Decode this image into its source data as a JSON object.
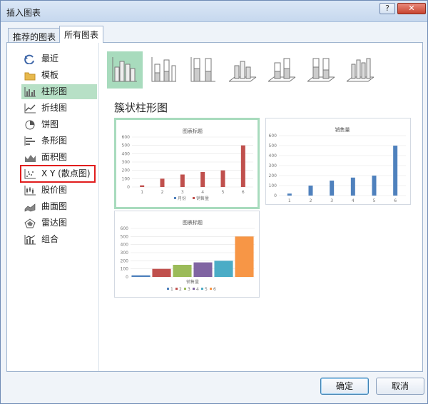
{
  "window": {
    "title": "插入图表",
    "help_glyph": "?",
    "close_glyph": "✕"
  },
  "tabs": [
    {
      "label": "推荐的图表"
    },
    {
      "label": "所有图表"
    }
  ],
  "sidebar": {
    "items": [
      {
        "label": "最近",
        "icon": "recent-icon"
      },
      {
        "label": "模板",
        "icon": "folder-icon"
      },
      {
        "label": "柱形图",
        "icon": "column-chart-icon"
      },
      {
        "label": "折线图",
        "icon": "line-chart-icon"
      },
      {
        "label": "饼图",
        "icon": "pie-chart-icon"
      },
      {
        "label": "条形图",
        "icon": "bar-chart-icon"
      },
      {
        "label": "面积图",
        "icon": "area-chart-icon"
      },
      {
        "label": "X Y (散点图)",
        "icon": "scatter-chart-icon"
      },
      {
        "label": "股价图",
        "icon": "stock-chart-icon"
      },
      {
        "label": "曲面图",
        "icon": "surface-chart-icon"
      },
      {
        "label": "雷达图",
        "icon": "radar-chart-icon"
      },
      {
        "label": "组合",
        "icon": "combo-chart-icon"
      }
    ],
    "selected_index": 2,
    "highlighted_index": 7
  },
  "subtype_heading": "簇状柱形图",
  "previews": [
    {
      "title": "图表标题",
      "yticks": [
        "0",
        "100",
        "200",
        "300",
        "400",
        "500",
        "600"
      ],
      "categories": [
        "1",
        "2",
        "3",
        "4",
        "5",
        "6"
      ],
      "legend": [
        "月份",
        "销售量"
      ],
      "values": [
        20,
        100,
        150,
        180,
        200,
        500
      ],
      "colors": [
        "#c0504d"
      ]
    },
    {
      "title": "销售量",
      "yticks": [
        "0",
        "100",
        "200",
        "300",
        "400",
        "500",
        "600"
      ],
      "categories": [
        "1",
        "2",
        "3",
        "4",
        "5",
        "6"
      ],
      "values": [
        20,
        100,
        150,
        180,
        200,
        500
      ],
      "colors": [
        "#4f81bd"
      ]
    },
    {
      "title": "图表标题",
      "yticks": [
        "0",
        "100",
        "200",
        "300",
        "400",
        "500",
        "600"
      ],
      "xlabel": "销售量",
      "legend": [
        "1",
        "2",
        "3",
        "4",
        "5",
        "6"
      ],
      "values": [
        20,
        100,
        150,
        180,
        200,
        500
      ],
      "colors": [
        "#4f81bd",
        "#c0504d",
        "#9bbb59",
        "#8064a2",
        "#4bacc6",
        "#f79646"
      ]
    }
  ],
  "buttons": {
    "ok": "确定",
    "cancel": "取消"
  },
  "colors": {
    "accent": "#a8dbbd",
    "highlight_box": "#e11d1d"
  }
}
